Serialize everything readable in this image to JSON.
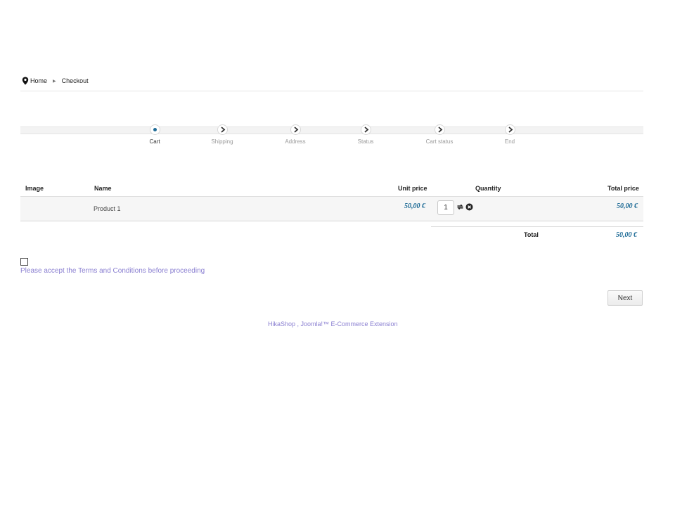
{
  "breadcrumb": {
    "home": "Home",
    "current": "Checkout"
  },
  "steps": [
    {
      "label": "Cart",
      "active": true
    },
    {
      "label": "Shipping",
      "active": false
    },
    {
      "label": "Address",
      "active": false
    },
    {
      "label": "Status",
      "active": false
    },
    {
      "label": "Cart status",
      "active": false
    },
    {
      "label": "End",
      "active": false
    }
  ],
  "table": {
    "headers": {
      "image": "Image",
      "name": "Name",
      "unit_price": "Unit price",
      "quantity": "Quantity",
      "total_price": "Total price"
    },
    "rows": [
      {
        "name": "Product 1",
        "unit_price": "50,00 €",
        "quantity": "1",
        "total_price": "50,00 €"
      }
    ],
    "total_label": "Total",
    "total_value": "50,00 €"
  },
  "terms": {
    "text": "Please accept the Terms and Conditions before proceeding",
    "checked": false
  },
  "next_label": "Next",
  "footer": {
    "text": "HikaShop , Joomla!™ E-Commerce Extension"
  },
  "colors": {
    "accent": "#1e6b96",
    "link": "#8a7fd1"
  }
}
